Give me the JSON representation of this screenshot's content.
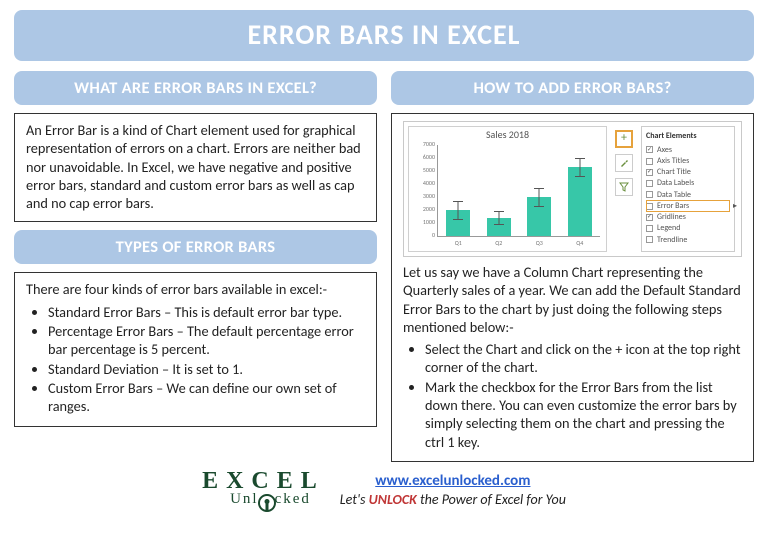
{
  "title": "ERROR BARS IN EXCEL",
  "left": {
    "heading_what": "WHAT ARE ERROR BARS IN EXCEL?",
    "what_body": "An Error Bar is a kind of Chart element used for graphical representation of errors on a chart. Errors are neither bad nor unavoidable. In Excel, we have negative and positive error bars, standard and custom error bars as well as cap and no cap error bars.",
    "heading_types": "TYPES OF ERROR BARS",
    "types_intro": "There are four kinds of error bars available in excel:-",
    "types_items": [
      "Standard Error Bars – This is default error bar type.",
      "Percentage Error Bars – The default percentage error bar percentage is 5 percent.",
      "Standard Deviation – It is set to 1.",
      "Custom Error Bars – We can define our own set of ranges."
    ]
  },
  "right": {
    "heading_how": "HOW TO ADD ERROR BARS?",
    "how_intro": "Let us say we have a Column Chart representing the Quarterly sales of a year. We can add the Default Standard Error Bars to the chart by just doing the following steps mentioned below:-",
    "how_items": [
      "Select the Chart and click on the + icon at the top right corner of the chart.",
      "Mark the checkbox for the Error Bars from the list down there. You can even customize the error bars by simply selecting them on the chart and pressing the ctrl 1 key."
    ]
  },
  "chart": {
    "title": "Sales 2018",
    "panel_title": "Chart Elements",
    "elements": [
      {
        "label": "Axes",
        "checked": true,
        "hl": false
      },
      {
        "label": "Axis Titles",
        "checked": false,
        "hl": false
      },
      {
        "label": "Chart Title",
        "checked": true,
        "hl": false
      },
      {
        "label": "Data Labels",
        "checked": false,
        "hl": false
      },
      {
        "label": "Data Table",
        "checked": false,
        "hl": false
      },
      {
        "label": "Error Bars",
        "checked": false,
        "hl": true
      },
      {
        "label": "Gridlines",
        "checked": true,
        "hl": false
      },
      {
        "label": "Legend",
        "checked": false,
        "hl": false
      },
      {
        "label": "Trendline",
        "checked": false,
        "hl": false
      }
    ]
  },
  "chart_data": {
    "type": "bar",
    "title": "Sales 2018",
    "categories": [
      "Q1",
      "Q2",
      "Q3",
      "Q4"
    ],
    "values": [
      2000,
      1400,
      3000,
      5300
    ],
    "errors": [
      700,
      500,
      700,
      700
    ],
    "ylim": [
      0,
      7000
    ],
    "yticks": [
      0,
      1000,
      2000,
      3000,
      4000,
      5000,
      6000,
      7000
    ],
    "xlabel": "",
    "ylabel": ""
  },
  "footer": {
    "logo_top": "E X C E L",
    "logo_bottom": "Unl  cked",
    "site": "www.excelunlocked.com",
    "tag_before": "Let's ",
    "tag_unlock": "UNLOCK",
    "tag_after": " the Power of Excel for You"
  }
}
